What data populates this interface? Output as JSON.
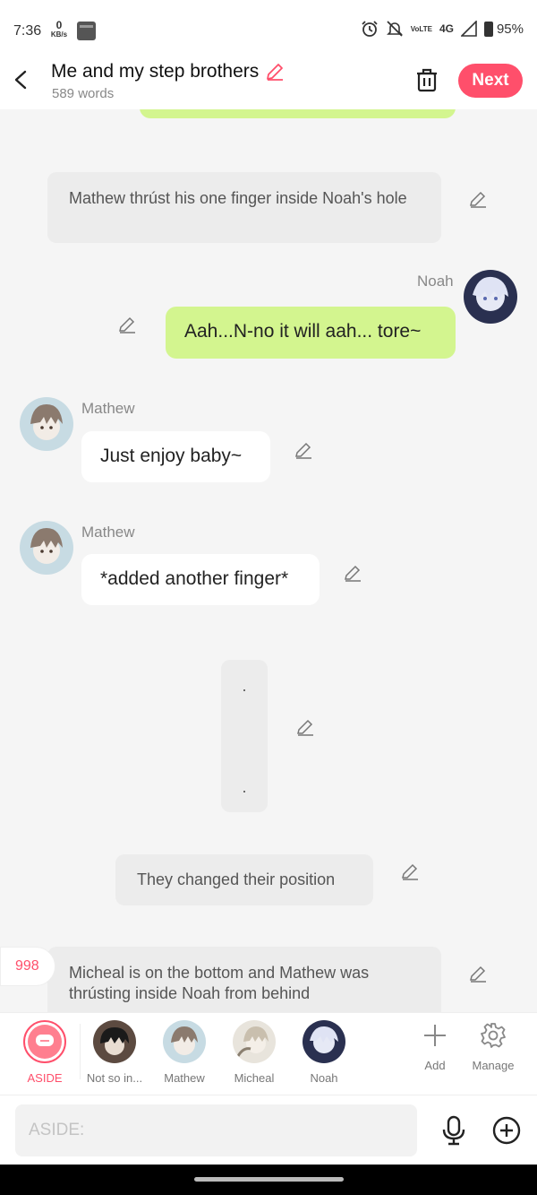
{
  "status": {
    "time": "7:36",
    "speed_value": "0",
    "speed_unit": "KB/s",
    "volte": "VoLTE",
    "network": "4G",
    "battery": "95%"
  },
  "header": {
    "title": "Me and my step brothers",
    "word_count": "589 words",
    "next_label": "Next"
  },
  "messages": [
    {
      "type": "narration",
      "text": "Mathew thrúst his one finger inside Noah's hole"
    },
    {
      "type": "right",
      "speaker": "Noah",
      "text": "Aah...N-no it will aah... tore~"
    },
    {
      "type": "left",
      "speaker": "Mathew",
      "text": "Just enjoy baby~"
    },
    {
      "type": "left",
      "speaker": "Mathew",
      "text": "*added another finger*"
    },
    {
      "type": "narration",
      "text_top": ".",
      "text_bottom": "."
    },
    {
      "type": "narration",
      "text": "They changed their position"
    },
    {
      "type": "narration",
      "text": "Micheal is on the bottom and Mathew was thrústing inside Noah from behind"
    }
  ],
  "counter": "998",
  "characters": [
    {
      "label": "ASIDE",
      "active": true
    },
    {
      "label": "Not so in..."
    },
    {
      "label": "Mathew"
    },
    {
      "label": "Micheal"
    },
    {
      "label": "Noah"
    }
  ],
  "tools": {
    "add_label": "Add",
    "manage_label": "Manage"
  },
  "input": {
    "placeholder": "ASIDE:"
  },
  "colors": {
    "accent": "#ff4f6b",
    "bubble_green": "#d3f58f",
    "narration_bg": "#ececec"
  }
}
